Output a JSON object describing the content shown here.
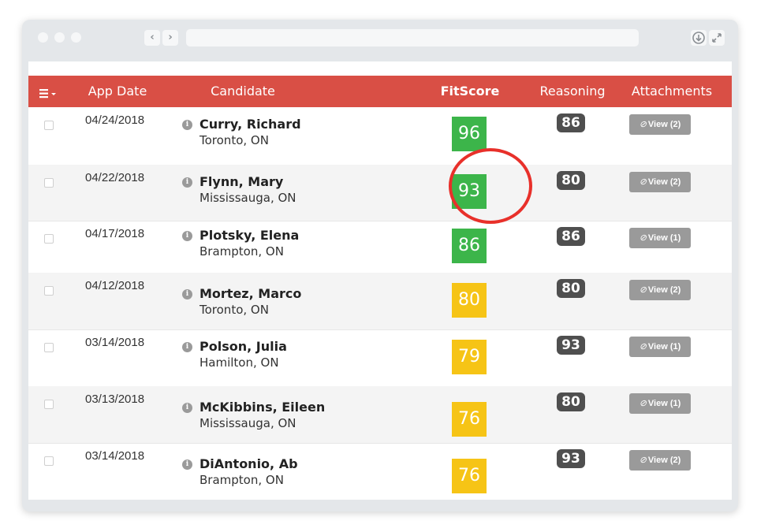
{
  "toolbar": {
    "back_icon": "chevron-left-icon",
    "forward_icon": "chevron-right-icon",
    "download_icon": "download-icon",
    "expand_icon": "expand-icon"
  },
  "table": {
    "headers": {
      "menu_icon": "column-menu-icon",
      "app_date": "App Date",
      "candidate": "Candidate",
      "fitscore": "FitScore",
      "reasoning": "Reasoning",
      "attachments": "Attachments"
    },
    "header_color": "#d94f45",
    "rows": [
      {
        "date": "04/24/2018",
        "name": "Curry, Richard",
        "city": "Toronto, ON",
        "fitscore": "96",
        "fit_color": "green",
        "reasoning": "86",
        "attachments": "View (2)"
      },
      {
        "date": "04/22/2018",
        "name": "Flynn, Mary",
        "city": "Mississauga, ON",
        "fitscore": "93",
        "fit_color": "green",
        "reasoning": "80",
        "attachments": "View (2)"
      },
      {
        "date": "04/17/2018",
        "name": "Plotsky, Elena",
        "city": "Brampton, ON",
        "fitscore": "86",
        "fit_color": "green",
        "reasoning": "86",
        "attachments": "View (1)"
      },
      {
        "date": "04/12/2018",
        "name": "Mortez, Marco",
        "city": "Toronto, ON",
        "fitscore": "80",
        "fit_color": "yellow",
        "reasoning": "80",
        "attachments": "View (2)"
      },
      {
        "date": "03/14/2018",
        "name": "Polson, Julia",
        "city": "Hamilton, ON",
        "fitscore": "79",
        "fit_color": "yellow",
        "reasoning": "93",
        "attachments": "View (1)"
      },
      {
        "date": "03/13/2018",
        "name": "McKibbins, Eileen",
        "city": "Mississauga, ON",
        "fitscore": "76",
        "fit_color": "yellow",
        "reasoning": "80",
        "attachments": "View (1)"
      },
      {
        "date": "03/14/2018",
        "name": "DiAntonio, Ab",
        "city": "Brampton, ON",
        "fitscore": "76",
        "fit_color": "yellow",
        "reasoning": "93",
        "attachments": "View (2)"
      }
    ]
  },
  "colors": {
    "fit_green": "#3cb54a",
    "fit_yellow": "#f6c416",
    "highlight_circle": "#e8302a"
  }
}
